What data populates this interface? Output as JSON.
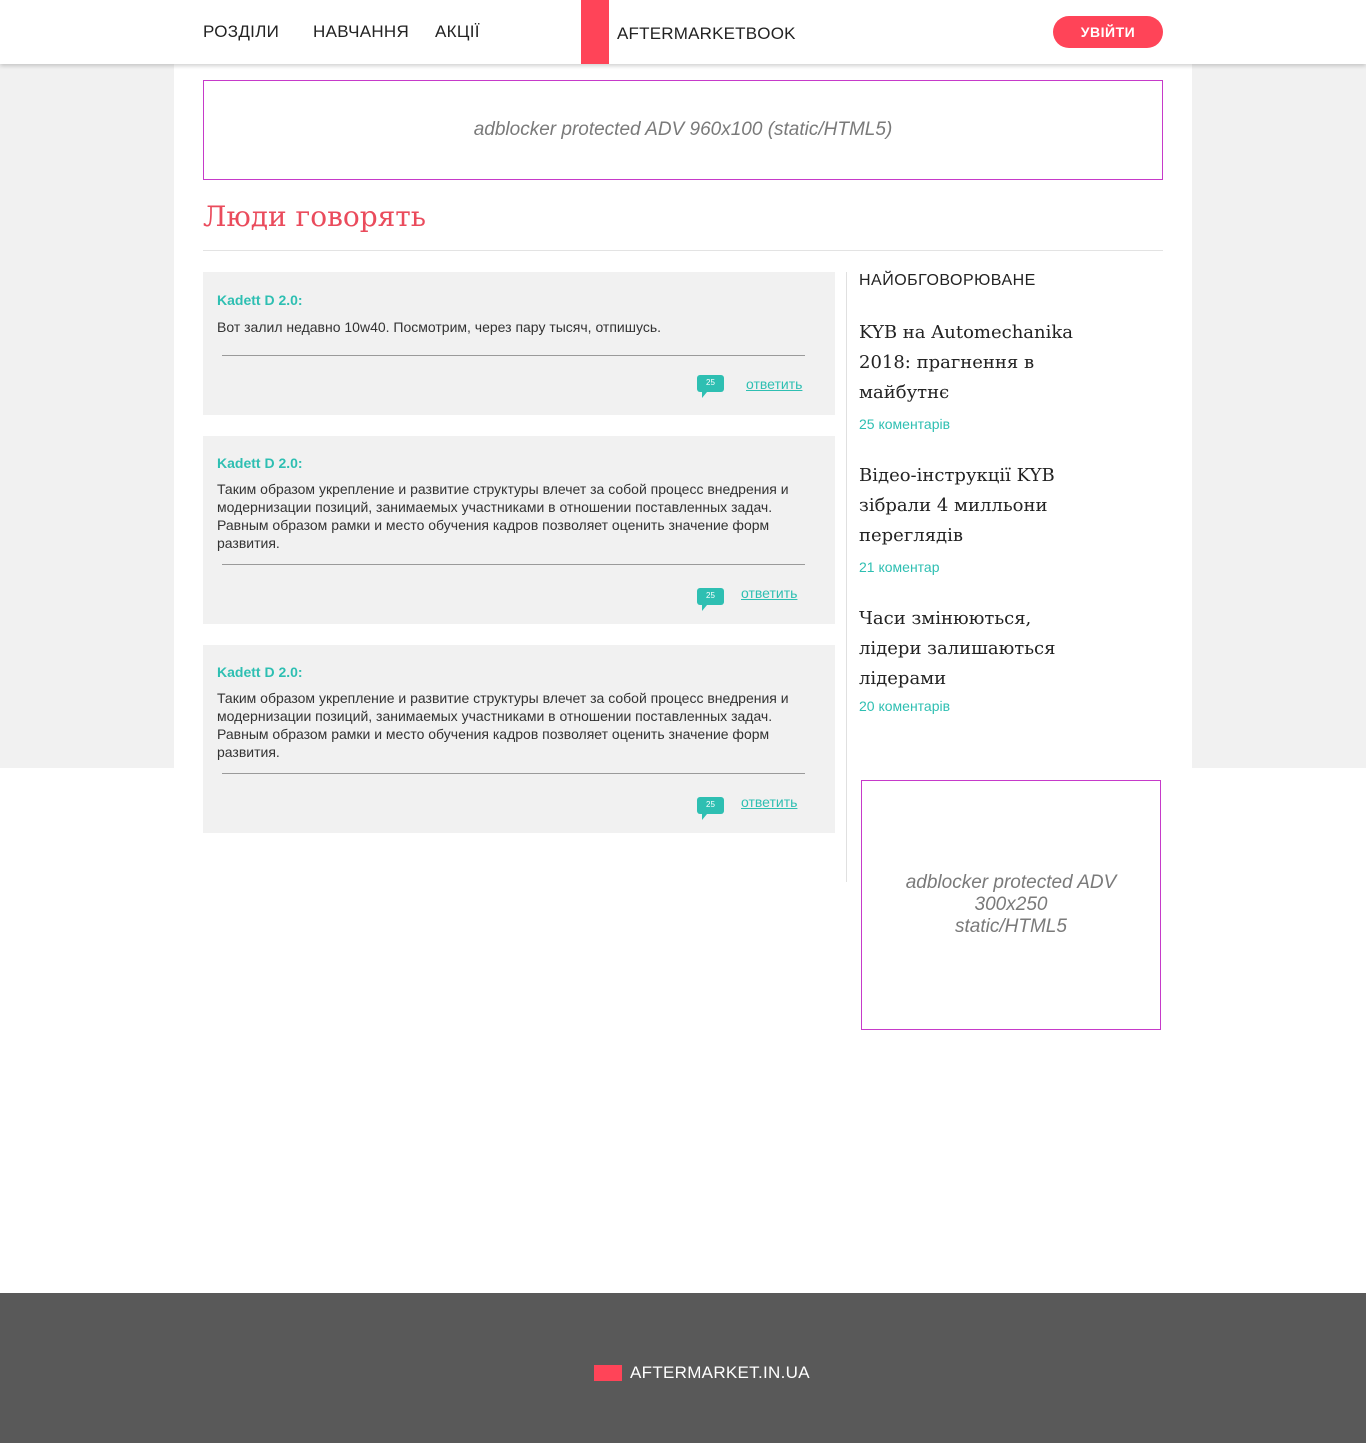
{
  "header": {
    "nav": [
      "РОЗДІЛИ",
      "НАВЧАННЯ",
      "АКЦІЇ"
    ],
    "logo": "AFTERMARKETBOOK",
    "login_label": "УВІЙТИ"
  },
  "ads": {
    "top": "adblocker protected ADV 960x100 (static/HTML5)",
    "side": [
      "adblocker protected ADV",
      "300x250",
      "static/HTML5"
    ]
  },
  "section_title": "Люди говорять",
  "comments": [
    {
      "author": "Kadett D 2.0:",
      "text": "Вот залил недавно 10w40. Посмотрим, через  пару тысяч, отпишусь.",
      "count": "25",
      "reply": "ответить"
    },
    {
      "author": "Kadett D 2.0:",
      "text": "Таким образом укрепление и развитие структуры влечет за собой процесс внедрения и модернизации позиций, занимаемых участниками в отношении поставленных задач. Равным образом рамки и место обучения кадров позволяет оценить значение форм развития.",
      "count": "25",
      "reply": "ответить"
    },
    {
      "author": "Kadett D 2.0:",
      "text": "Таким образом укрепление и развитие структуры влечет за собой процесс внедрения и модернизации позиций, занимаемых участниками в отношении поставленных задач. Равным образом рамки и место обучения кадров позволяет оценить значение форм развития.",
      "count": "25",
      "reply": "ответить"
    }
  ],
  "sidebar": {
    "heading": "НАЙОБГОВОРЮВАНЕ",
    "articles": [
      {
        "title": "KYB на Automechanika 2018: прагнення в майбутнє",
        "comments": "25 коментарів"
      },
      {
        "title": "Відео-інструкції KYB зібрали 4 милльони переглядів",
        "comments": "21 коментар"
      },
      {
        "title": "Часи змінюються, лідери залишаються лідерами",
        "comments": "20 коментарів"
      }
    ]
  },
  "footer": {
    "logo": "AFTERMARKET.IN.UA"
  },
  "colors": {
    "accent": "#ff4458",
    "teal": "#2ebfb2",
    "title_red": "#ea4b5c",
    "ad_border": "#c63ac9",
    "footer_bg": "#595959"
  }
}
